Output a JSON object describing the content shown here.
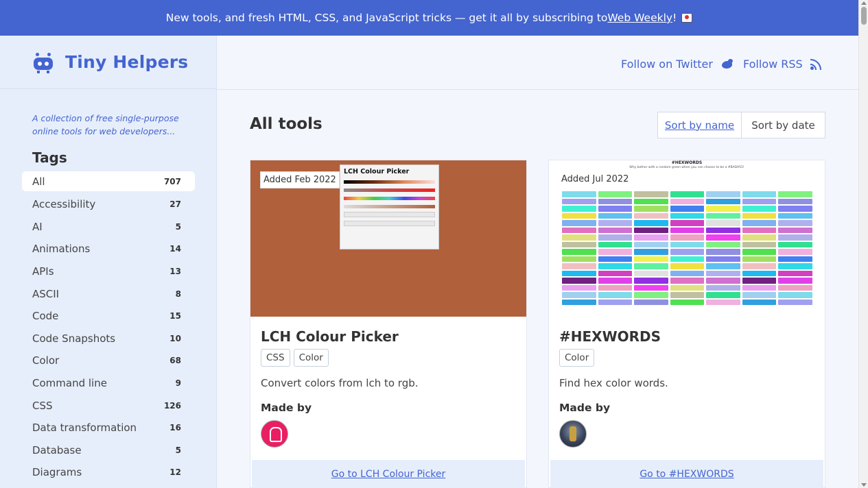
{
  "banner": {
    "text": "New tools, and fresh HTML, CSS, and JavaScript tricks — get it all by subscribing to ",
    "link": "Web Weekly",
    "suffix": "!"
  },
  "site": {
    "title": "Tiny Helpers",
    "tagline": "A collection of free single-purpose online tools for web developers..."
  },
  "header": {
    "twitter": "Follow on Twitter",
    "rss": "Follow RSS"
  },
  "sidebar": {
    "tags_heading": "Tags",
    "tags": [
      {
        "label": "All",
        "count": "707"
      },
      {
        "label": "Accessibility",
        "count": "27"
      },
      {
        "label": "AI",
        "count": "5"
      },
      {
        "label": "Animations",
        "count": "14"
      },
      {
        "label": "APIs",
        "count": "13"
      },
      {
        "label": "ASCII",
        "count": "8"
      },
      {
        "label": "Code",
        "count": "15"
      },
      {
        "label": "Code Snapshots",
        "count": "10"
      },
      {
        "label": "Color",
        "count": "68"
      },
      {
        "label": "Command line",
        "count": "9"
      },
      {
        "label": "CSS",
        "count": "126"
      },
      {
        "label": "Data transformation",
        "count": "16"
      },
      {
        "label": "Database",
        "count": "5"
      },
      {
        "label": "Diagrams",
        "count": "12"
      }
    ]
  },
  "main": {
    "title": "All tools",
    "sort_name": "Sort by name",
    "sort_date": "Sort by date"
  },
  "cards": [
    {
      "added": "Added Feb 2022",
      "title": "LCH Colour Picker",
      "tags": [
        "CSS",
        "Color"
      ],
      "description": "Convert colors from lch to rgb.",
      "made_by": "Made by",
      "goto": "Go to LCH Colour Picker",
      "preview_title": "LCH Colour Picker"
    },
    {
      "added": "Added Jul 2022",
      "title": "#HEXWORDS",
      "tags": [
        "Color"
      ],
      "description": "Find hex color words.",
      "made_by": "Made by",
      "goto": "Go to #HEXWORDS",
      "preview_title": "#HEXWORDS",
      "preview_sub": "Why bother with a random green when you can choose to be a #BADA55!"
    }
  ],
  "colors": {
    "accent": "#4464cf",
    "sidebar": "#e6eefb",
    "page": "#f3f6fd",
    "lch_bg": "#b0603a"
  }
}
